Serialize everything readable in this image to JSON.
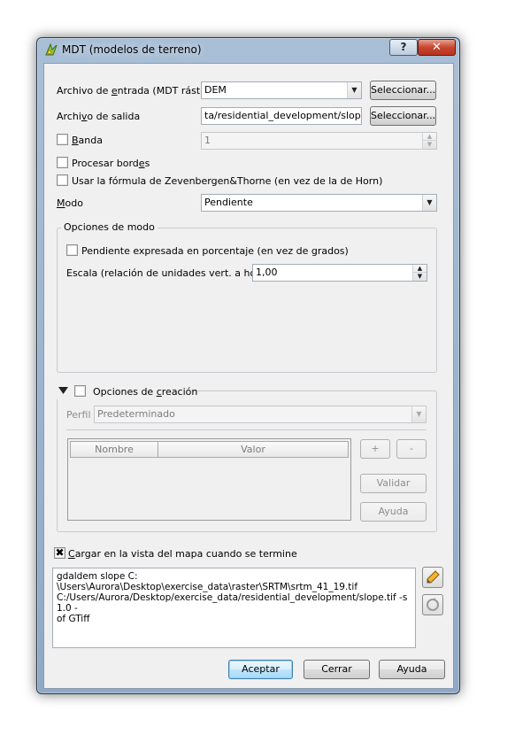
{
  "window": {
    "title": "MDT (modelos de terreno)",
    "help_label": "?",
    "close_label": "✕"
  },
  "form": {
    "input_label_pre": "Archivo de ",
    "input_label_u": "e",
    "input_label_post": "ntrada (MDT ráster)",
    "input_value": "DEM",
    "output_label_pre": "Archi",
    "output_label_u": "v",
    "output_label_post": "o de salida",
    "output_value": "ta/residential_development/slope.tif",
    "select_label": "Seleccionar...",
    "band_label_u": "B",
    "band_label_post": "anda",
    "band_value": "1",
    "edges_label_pre": "Procesar bord",
    "edges_label_u": "e",
    "edges_label_post": "s",
    "zevenbergen_label": "Usar la fórmula de Zevenbergen&Thorne (en vez de la de Horn)",
    "mode_label_u": "M",
    "mode_label_post": "odo",
    "mode_value": "Pendiente"
  },
  "mode_options": {
    "legend": "Opciones de modo",
    "percent_label": "Pendiente expresada en porcentaje (en vez de grados)",
    "scale_label": "Escala (relación de unidades vert. a horiz.)",
    "scale_value": "1,00"
  },
  "creation_options": {
    "legend_pre": "Opciones de ",
    "legend_u": "c",
    "legend_post": "reación",
    "profile_label": "Perfil",
    "profile_value": "Predeterminado",
    "table_headers": [
      "Nombre",
      "Valor"
    ],
    "add_label": "+",
    "remove_label": "-",
    "validate_label": "Validar",
    "help_label": "Ayuda"
  },
  "load": {
    "label_u": "C",
    "label_post": "argar en la vista del mapa cuando se termine",
    "checked_mark": "✖"
  },
  "command": {
    "text": "gdaldem slope C:\n\\Users\\Aurora\\Desktop\\exercise_data\\raster\\SRTM\\srtm_41_19.tif\nC:/Users/Aurora/Desktop/exercise_data/residential_development/slope.tif -s 1.0 -\nof GTiff"
  },
  "footer": {
    "accept_label": "Aceptar",
    "close_label": "Cerrar",
    "help_label": "Ayuda"
  },
  "colors": {
    "window_frame": "#a9bfd6",
    "client_bg": "#f0f0f0",
    "close_button": "#c8452f",
    "default_button_border": "#3c7fb1"
  }
}
